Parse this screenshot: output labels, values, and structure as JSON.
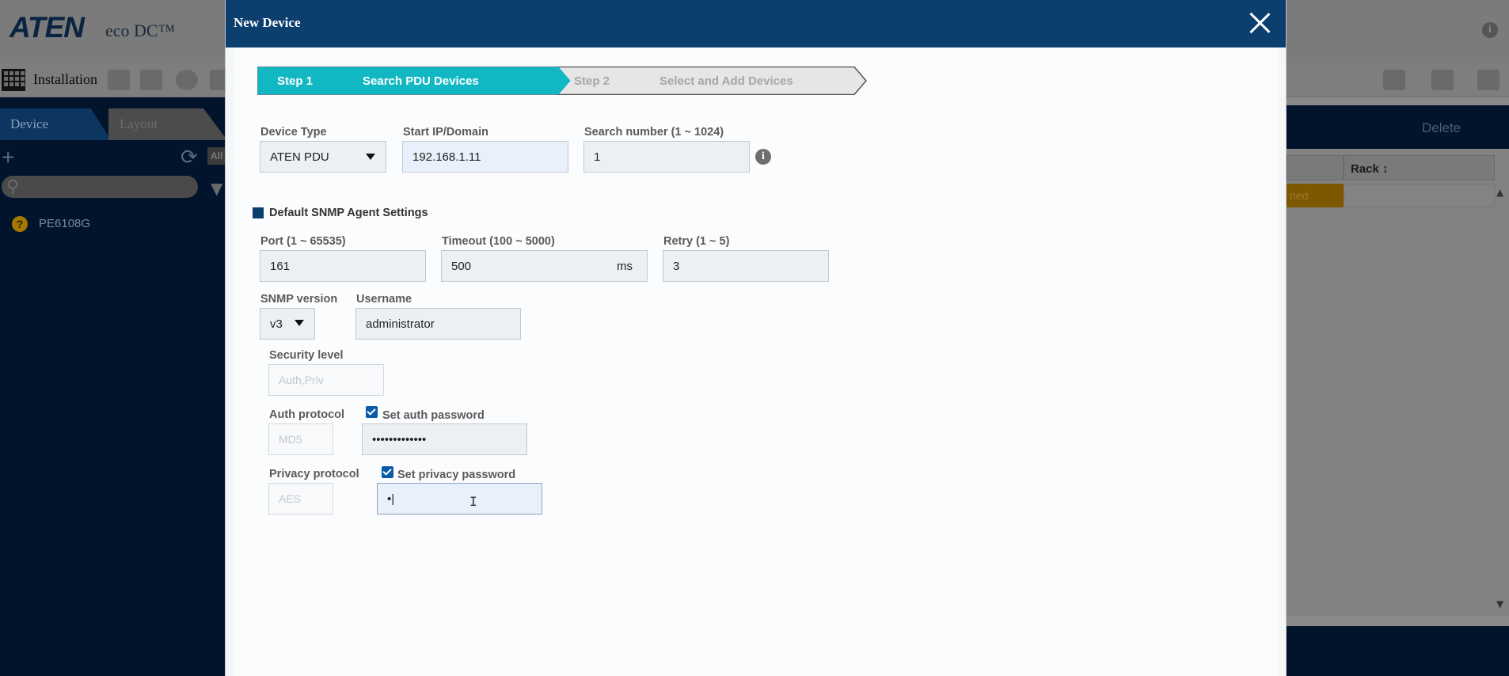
{
  "app": {
    "logo": "ATEN",
    "product": "eco DC™",
    "toolbar_title": "Installation",
    "sidebar": {
      "tabs": [
        {
          "label": "Device"
        },
        {
          "label": "Layout"
        }
      ],
      "filter_badge": "All",
      "devices": [
        {
          "name": "PE6108G",
          "status": "unknown"
        }
      ]
    },
    "right_panel": {
      "delete_label": "Delete",
      "rack_header": "Rack ↕",
      "status_cell": "ned"
    }
  },
  "modal": {
    "title": "New Device",
    "steps": [
      {
        "number": "Step 1",
        "title": "Search PDU Devices",
        "active": true
      },
      {
        "number": "Step 2",
        "title": "Select and Add Devices",
        "active": false
      }
    ],
    "device_type": {
      "label": "Device Type",
      "value": "ATEN PDU"
    },
    "start_ip": {
      "label": "Start IP/Domain",
      "value": "192.168.1.11"
    },
    "search_number": {
      "label": "Search number (1 ~ 1024)",
      "value": "1"
    },
    "snmp_section_title": "Default SNMP Agent Settings",
    "port": {
      "label": "Port (1 ~ 65535)",
      "value": "161"
    },
    "timeout": {
      "label": "Timeout (100 ~ 5000)",
      "value": "500",
      "unit": "ms"
    },
    "retry": {
      "label": "Retry (1 ~ 5)",
      "value": "3"
    },
    "snmp_version": {
      "label": "SNMP version",
      "value": "v3"
    },
    "username": {
      "label": "Username",
      "value": "administrator"
    },
    "security_level": {
      "label": "Security level",
      "value": "Auth,Priv"
    },
    "auth_protocol": {
      "label": "Auth protocol",
      "value": "MD5"
    },
    "set_auth_password": {
      "label": "Set auth password",
      "checked": true,
      "value": "•••••••••••••"
    },
    "privacy_protocol": {
      "label": "Privacy protocol",
      "value": "AES"
    },
    "set_privacy_password": {
      "label": "Set privacy password",
      "checked": true,
      "value": "•|"
    }
  },
  "colors": {
    "header_navy": "#0c3e6e",
    "step_active": "#11b8c4",
    "sidebar_dark": "#01142c",
    "checkbox_blue": "#0a5aa8"
  }
}
